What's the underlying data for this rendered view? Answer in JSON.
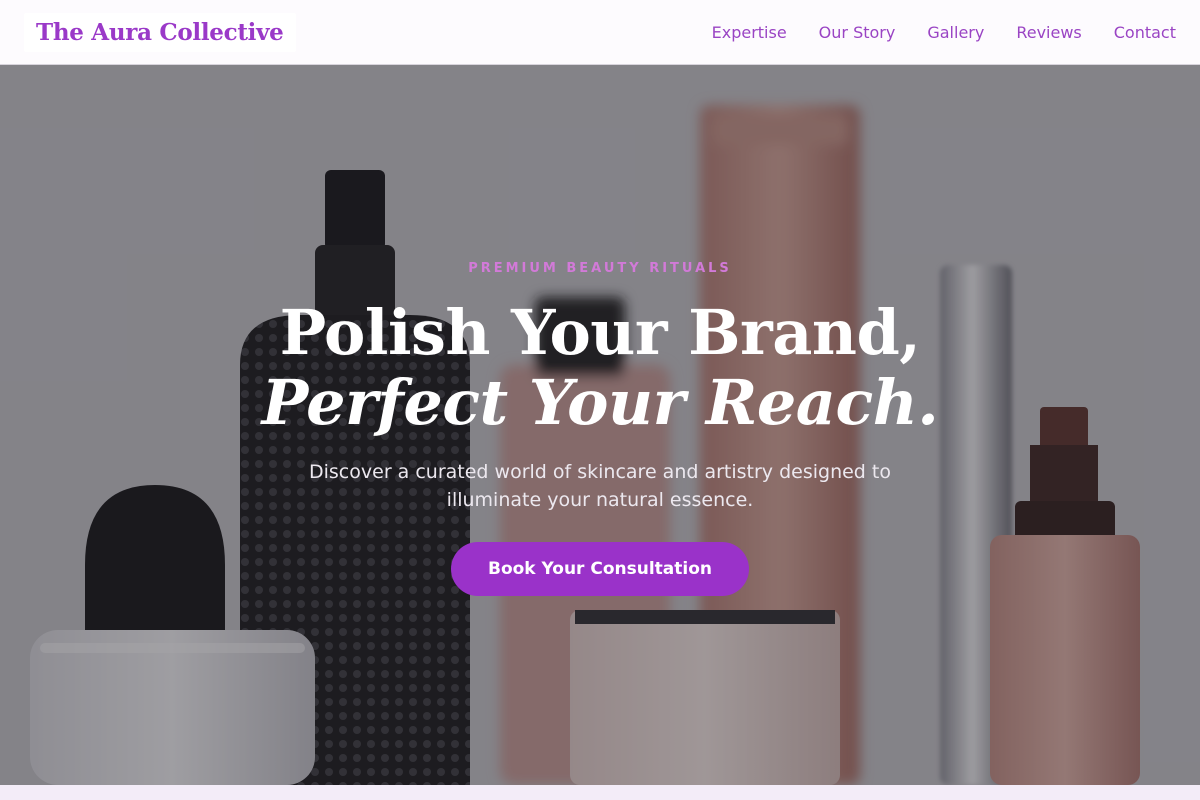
{
  "header": {
    "brand": "The Aura Collective",
    "nav": [
      "Expertise",
      "Our Story",
      "Gallery",
      "Reviews",
      "Contact"
    ]
  },
  "hero": {
    "eyebrow": "PREMIUM BEAUTY RITUALS",
    "headline_line1": "Polish Your Brand,",
    "headline_line2": "Perfect Your Reach.",
    "subtitle": "Discover a curated world of skincare and artistry designed to illuminate your natural essence.",
    "cta_label": "Book Your Consultation"
  },
  "colors": {
    "accent": "#9a32c9",
    "brand_text": "#9a39c8",
    "eyebrow": "#d27ad8",
    "header_bg": "#fdfbfe"
  }
}
